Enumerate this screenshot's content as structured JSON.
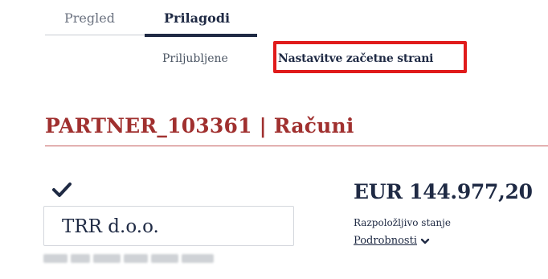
{
  "tabs": {
    "overview_label": "Pregled",
    "customize_label": "Prilagodi"
  },
  "subtabs": {
    "favorites_label": "Priljubljene",
    "homepage_settings_label": "Nastavitve začetne strani"
  },
  "page": {
    "title": "PARTNER_103361 | Računi"
  },
  "account": {
    "name": "TRR d.o.o.",
    "balance": "EUR 144.977,20",
    "balance_label": "Razpoložljivo stanje",
    "details_label": "Podrobnosti"
  },
  "icons": {
    "selected": "check-icon",
    "details_toggle": "chevron-down-icon"
  },
  "colors": {
    "navy": "#1f2a44",
    "title_red": "#a0302f",
    "highlight": "#e01b1b"
  }
}
